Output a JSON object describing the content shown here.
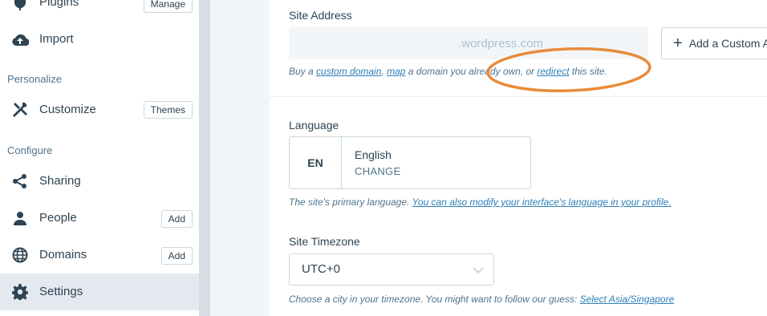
{
  "sidebar": {
    "items": [
      {
        "label": "Plugins",
        "icon": "plugin-icon",
        "pill": "Manage"
      },
      {
        "label": "Import",
        "icon": "cloud-upload-icon",
        "pill": ""
      },
      {
        "label": "Customize",
        "icon": "tools-icon",
        "pill": "Themes"
      },
      {
        "label": "Sharing",
        "icon": "share-icon",
        "pill": ""
      },
      {
        "label": "People",
        "icon": "person-icon",
        "pill": "Add"
      },
      {
        "label": "Domains",
        "icon": "globe-icon",
        "pill": "Add"
      },
      {
        "label": "Settings",
        "icon": "gear-icon",
        "pill": ""
      }
    ],
    "section_personalize": "Personalize",
    "section_configure": "Configure"
  },
  "site_address": {
    "label": "Site Address",
    "placeholder": ".wordpress.com",
    "add_button": "Add a Custom A",
    "hint_prefix": "Buy a ",
    "link_custom_domain": "custom domain",
    "hint_comma": ", ",
    "link_map": "map",
    "hint_mid": " a domain you already own, or ",
    "link_redirect": "redirect",
    "hint_suffix": " this site."
  },
  "language": {
    "label": "Language",
    "code": "EN",
    "name": "English",
    "change": "CHANGE",
    "hint_prefix": "The site's primary language. ",
    "hint_link": "You can also modify your interface's language in your profile."
  },
  "timezone": {
    "label": "Site Timezone",
    "value": "UTC+0",
    "hint_prefix": "Choose a city in your timezone. You might want to follow our guess: ",
    "hint_link": "Select Asia/Singapore"
  },
  "colors": {
    "accent": "#2e7fb7",
    "annotation": "#e98b3b",
    "text": "#2e4453"
  }
}
